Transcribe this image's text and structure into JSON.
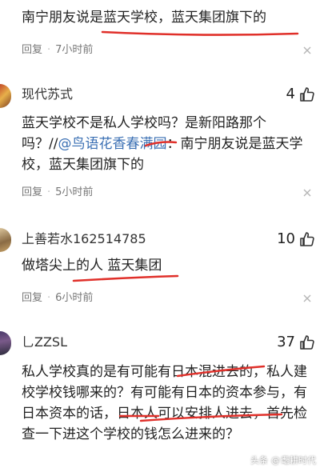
{
  "comments": [
    {
      "text": "南宁朋友说是蓝天学校，蓝天集团旗下的",
      "reply": "回复",
      "time": "7小时前"
    },
    {
      "username": "现代苏式",
      "likes": "4",
      "text_before": "蓝天学校不是私人学校吗？是新阳路那个吗？//",
      "mention": "@鸟语花香春满园",
      "text_after": "：南宁朋友说是蓝天学校，蓝天集团旗下的",
      "reply": "回复",
      "time": "5小时前"
    },
    {
      "username": "上善若水162514785",
      "likes": "10",
      "text": "做塔尖上的人 蓝天集团",
      "reply": "回复",
      "time": "6小时前"
    },
    {
      "username": "乚ZZSL",
      "likes": "37",
      "text": "私人学校真的是有可能有日本混进去的，私人建校学校钱哪来的？有可能有日本的资本参与，有日本资本的话，日本人可以安排人进去，首先检查一下进这个学校的钱怎么进来的？"
    }
  ],
  "watermark": {
    "platform": "头条",
    "account": "耄耕时代"
  },
  "colors": {
    "underline": "#e0302a",
    "mention": "#3a6fb3",
    "meta": "#777777"
  },
  "icons": [
    "thumb-up-icon",
    "close-icon",
    "avatar"
  ]
}
